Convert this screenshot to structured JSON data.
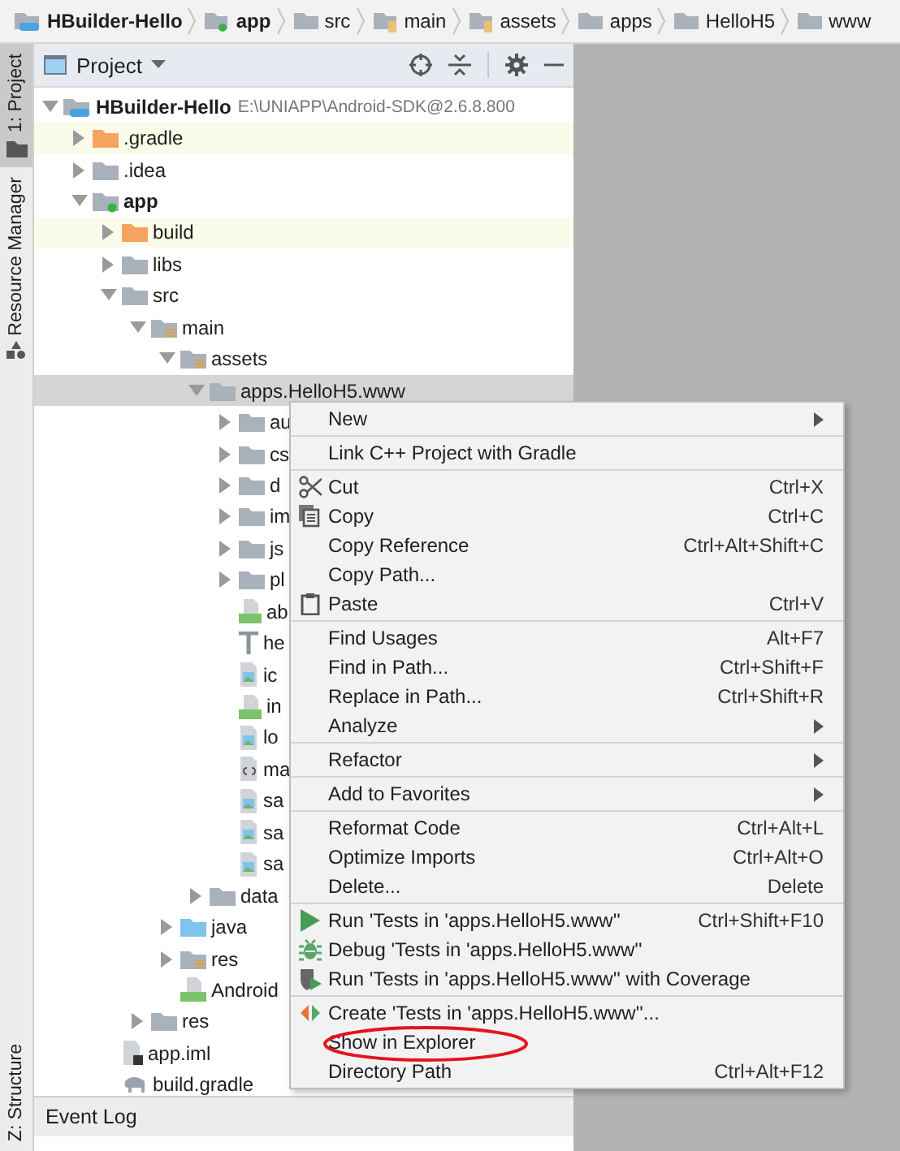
{
  "breadcrumb": [
    {
      "label": "HBuilder-Hello",
      "kind": "module"
    },
    {
      "label": "app",
      "kind": "app"
    },
    {
      "label": "src",
      "kind": "folder"
    },
    {
      "label": "main",
      "kind": "res"
    },
    {
      "label": "assets",
      "kind": "res"
    },
    {
      "label": "apps",
      "kind": "folder"
    },
    {
      "label": "HelloH5",
      "kind": "folder"
    },
    {
      "label": "www",
      "kind": "folder"
    }
  ],
  "side_tabs": [
    {
      "label": "1: Project",
      "selected": true,
      "kind": "project"
    },
    {
      "label": "Resource Manager",
      "selected": false,
      "kind": "resource"
    }
  ],
  "bottom_side_tab": {
    "label": "Z: Structure"
  },
  "panel": {
    "title": "Project"
  },
  "tree": [
    {
      "label": "HBuilder-Hello",
      "kind": "module",
      "path": "E:\\UNIAPP\\Android-SDK@2.6.8.800",
      "expanded": true,
      "selected": false,
      "highlighted": false,
      "children": [
        {
          "label": ".gradle",
          "kind": "folder-orange",
          "expanded": false,
          "selected": false,
          "highlighted": true
        },
        {
          "label": ".idea",
          "kind": "folder",
          "expanded": false,
          "selected": false,
          "highlighted": false
        },
        {
          "label": "app",
          "kind": "app",
          "expanded": true,
          "selected": false,
          "highlighted": false,
          "children": [
            {
              "label": "build",
              "kind": "folder-orange",
              "expanded": false,
              "selected": false,
              "highlighted": true
            },
            {
              "label": "libs",
              "kind": "folder",
              "expanded": false,
              "selected": false,
              "highlighted": false
            },
            {
              "label": "src",
              "kind": "folder",
              "expanded": true,
              "selected": false,
              "highlighted": false,
              "children": [
                {
                  "label": "main",
                  "kind": "res",
                  "expanded": true,
                  "selected": false,
                  "highlighted": false,
                  "children": [
                    {
                      "label": "assets",
                      "kind": "res",
                      "expanded": true,
                      "selected": false,
                      "highlighted": false,
                      "children": [
                        {
                          "label": "apps.HelloH5.www",
                          "kind": "folder",
                          "expanded": true,
                          "selected": true,
                          "highlighted": false,
                          "children": [
                            {
                              "label": "au",
                              "kind": "folder",
                              "expanded": false,
                              "selected": false,
                              "highlighted": false
                            },
                            {
                              "label": "cs",
                              "kind": "folder",
                              "expanded": false,
                              "selected": false,
                              "highlighted": false
                            },
                            {
                              "label": "d",
                              "kind": "folder",
                              "expanded": false,
                              "selected": false,
                              "highlighted": false
                            },
                            {
                              "label": "im",
                              "kind": "folder",
                              "expanded": false,
                              "selected": false,
                              "highlighted": false
                            },
                            {
                              "label": "js",
                              "kind": "folder",
                              "expanded": false,
                              "selected": false,
                              "highlighted": false
                            },
                            {
                              "label": "pl",
                              "kind": "folder",
                              "expanded": false,
                              "selected": false,
                              "highlighted": false
                            },
                            {
                              "label": "ab",
                              "kind": "html",
                              "selected": false,
                              "highlighted": false
                            },
                            {
                              "label": "he",
                              "kind": "text",
                              "selected": false,
                              "highlighted": false
                            },
                            {
                              "label": "ic",
                              "kind": "image",
                              "selected": false,
                              "highlighted": false
                            },
                            {
                              "label": "in",
                              "kind": "html",
                              "selected": false,
                              "highlighted": false
                            },
                            {
                              "label": "lo",
                              "kind": "image",
                              "selected": false,
                              "highlighted": false
                            },
                            {
                              "label": "ma",
                              "kind": "json",
                              "selected": false,
                              "highlighted": false
                            },
                            {
                              "label": "sa",
                              "kind": "image",
                              "selected": false,
                              "highlighted": false
                            },
                            {
                              "label": "sa",
                              "kind": "image",
                              "selected": false,
                              "highlighted": false
                            },
                            {
                              "label": "sa",
                              "kind": "image",
                              "selected": false,
                              "highlighted": false
                            }
                          ]
                        },
                        {
                          "label": "data",
                          "kind": "folder",
                          "expanded": false,
                          "selected": false,
                          "highlighted": false
                        }
                      ]
                    },
                    {
                      "label": "java",
                      "kind": "folder-blue",
                      "expanded": false,
                      "selected": false,
                      "highlighted": false
                    },
                    {
                      "label": "res",
                      "kind": "res",
                      "expanded": false,
                      "selected": false,
                      "highlighted": false
                    },
                    {
                      "label": "Android",
                      "kind": "manifest",
                      "selected": false,
                      "highlighted": false
                    }
                  ]
                },
                {
                  "label": "res",
                  "kind": "folder",
                  "expanded": false,
                  "selected": false,
                  "highlighted": false
                }
              ]
            },
            {
              "label": "app.iml",
              "kind": "iml",
              "selected": false,
              "highlighted": false
            },
            {
              "label": "build.gradle",
              "kind": "gradle",
              "selected": false,
              "highlighted": false
            }
          ]
        }
      ]
    }
  ],
  "event_log": {
    "label": "Event Log"
  },
  "context_menu": [
    {
      "kind": "item",
      "label": "New",
      "submenu": true
    },
    {
      "kind": "separator"
    },
    {
      "kind": "item",
      "label": "Link C++ Project with Gradle"
    },
    {
      "kind": "separator"
    },
    {
      "kind": "item",
      "label": "Cut",
      "shortcut": "Ctrl+X"
    },
    {
      "kind": "item",
      "label": "Copy",
      "shortcut": "Ctrl+C"
    },
    {
      "kind": "item",
      "label": "Copy Reference",
      "shortcut": "Ctrl+Alt+Shift+C"
    },
    {
      "kind": "item",
      "label": "Copy Path..."
    },
    {
      "kind": "item",
      "label": "Paste",
      "shortcut": "Ctrl+V"
    },
    {
      "kind": "separator"
    },
    {
      "kind": "item",
      "label": "Find Usages",
      "shortcut": "Alt+F7"
    },
    {
      "kind": "item",
      "label": "Find in Path...",
      "shortcut": "Ctrl+Shift+F"
    },
    {
      "kind": "item",
      "label": "Replace in Path...",
      "shortcut": "Ctrl+Shift+R"
    },
    {
      "kind": "item",
      "label": "Analyze",
      "submenu": true
    },
    {
      "kind": "separator"
    },
    {
      "kind": "item",
      "label": "Refactor",
      "submenu": true
    },
    {
      "kind": "separator"
    },
    {
      "kind": "item",
      "label": "Add to Favorites",
      "submenu": true
    },
    {
      "kind": "separator"
    },
    {
      "kind": "item",
      "label": "Reformat Code",
      "shortcut": "Ctrl+Alt+L"
    },
    {
      "kind": "item",
      "label": "Optimize Imports",
      "shortcut": "Ctrl+Alt+O"
    },
    {
      "kind": "item",
      "label": "Delete...",
      "shortcut": "Delete"
    },
    {
      "kind": "separator"
    },
    {
      "kind": "item",
      "label": "Run 'Tests in 'apps.HelloH5.www''",
      "shortcut": "Ctrl+Shift+F10"
    },
    {
      "kind": "item",
      "label": "Debug 'Tests in 'apps.HelloH5.www''"
    },
    {
      "kind": "item",
      "label": "Run 'Tests in 'apps.HelloH5.www'' with Coverage"
    },
    {
      "kind": "separator"
    },
    {
      "kind": "item",
      "label": "Create 'Tests in 'apps.HelloH5.www''..."
    },
    {
      "kind": "item",
      "label": "Show in Explorer",
      "circled": true
    },
    {
      "kind": "item",
      "label": "Directory Path",
      "shortcut": "Ctrl+Alt+F12"
    }
  ]
}
